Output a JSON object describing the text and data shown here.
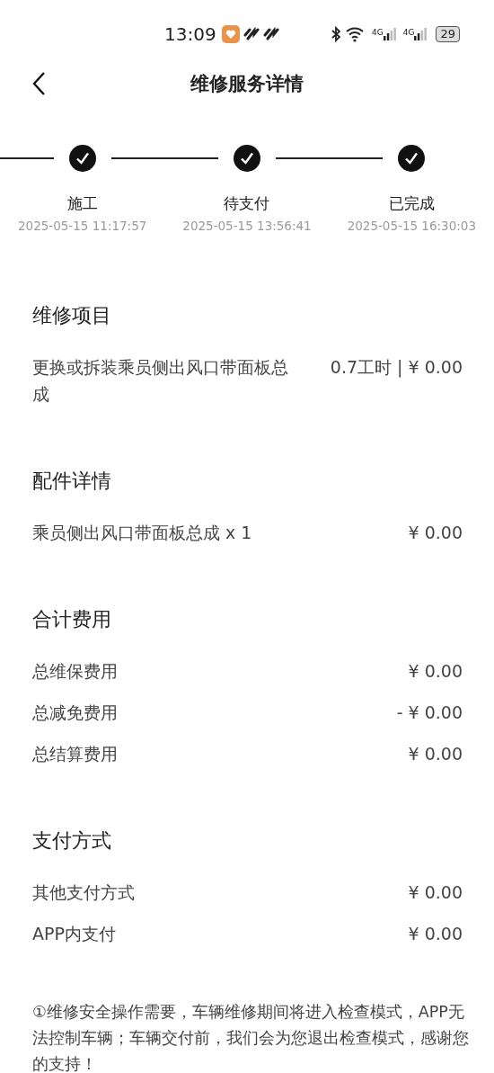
{
  "status_bar": {
    "time": "13:09",
    "networks": [
      "4G",
      "4G"
    ],
    "battery": "29"
  },
  "header": {
    "title": "维修服务详情"
  },
  "steps": [
    {
      "label": "施工",
      "time": "2025-05-15 11:17:57",
      "done": true
    },
    {
      "label": "待支付",
      "time": "2025-05-15 13:56:41",
      "done": true
    },
    {
      "label": "已完成",
      "time": "2025-05-15 16:30:03",
      "done": true
    }
  ],
  "sections": [
    {
      "title": "维修项目",
      "rows": [
        {
          "label": "更换或拆装乘员侧出风口带面板总成",
          "value": "0.7工时 | ¥ 0.00"
        }
      ]
    },
    {
      "title": "配件详情",
      "rows": [
        {
          "label": "乘员侧出风口带面板总成 x 1",
          "value": "¥ 0.00"
        }
      ]
    },
    {
      "title": "合计费用",
      "rows": [
        {
          "label": "总维保费用",
          "value": "¥ 0.00"
        },
        {
          "label": "总减免费用",
          "value": "- ¥ 0.00"
        },
        {
          "label": "总结算费用",
          "value": "¥ 0.00"
        }
      ]
    },
    {
      "title": "支付方式",
      "rows": [
        {
          "label": "其他支付方式",
          "value": "¥ 0.00"
        },
        {
          "label": "APP内支付",
          "value": "¥ 0.00"
        }
      ]
    }
  ],
  "footnote": "①维修安全操作需要，车辆维修期间将进入检查模式，APP无法控制车辆；车辆交付前，我们会为您退出检查模式，感谢您的支持！"
}
